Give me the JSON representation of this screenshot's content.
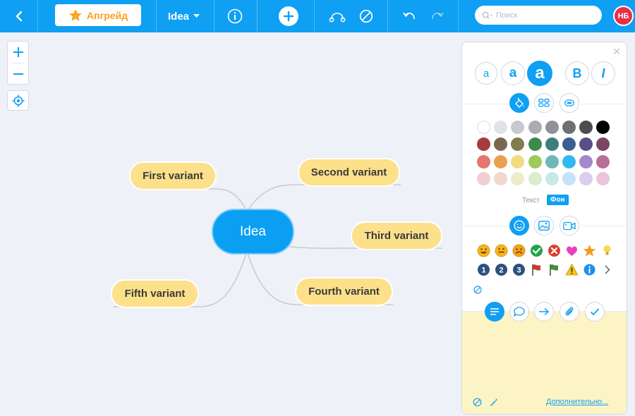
{
  "toolbar": {
    "upgrade_label": "Апгрейд",
    "map_name": "Idea",
    "search_placeholder": "Поиск",
    "avatar_initials": "НБ"
  },
  "map": {
    "root": "Idea",
    "nodes": [
      "First variant",
      "Second variant",
      "Third variant",
      "Fourth variant",
      "Fifth variant"
    ]
  },
  "panel": {
    "font_sizes": [
      "a",
      "a",
      "a"
    ],
    "bold_label": "B",
    "italic_label": "I",
    "color_tabs": {
      "text": "Текст",
      "background": "Фон"
    },
    "more_link": "Дополнительно..."
  },
  "colors": {
    "accent": "#0f9ff3",
    "node_fill": "#fde08a",
    "palette": [
      [
        "#ffffff",
        "#dfe3e8",
        "#c6c9cd",
        "#a9acb0",
        "#8f9296",
        "#6e7174",
        "#4b4d50",
        "#000000"
      ],
      [
        "#a73b3b",
        "#7b6651",
        "#827d4b",
        "#3c8a4d",
        "#3c7e7e",
        "#3b5f8e",
        "#5b4c8a",
        "#7b4662"
      ],
      [
        "#e4766f",
        "#eaa050",
        "#f3dc80",
        "#9ec95d",
        "#6fb7b7",
        "#2fb9f2",
        "#a489c9",
        "#b66f97"
      ],
      [
        "#f0cfcf",
        "#f1d8cb",
        "#eeeacc",
        "#d9eccc",
        "#c8e9e9",
        "#c6e2f6",
        "#dccdee",
        "#eac4dc"
      ]
    ]
  },
  "icons": {
    "row1": [
      "smile-icon",
      "grin-icon",
      "frown-icon",
      "check-icon",
      "cross-icon",
      "heart-icon",
      "star-icon",
      "bulb-icon"
    ],
    "row2": [
      "number-1-icon",
      "number-2-icon",
      "number-3-icon",
      "red-flag-icon",
      "green-flag-icon",
      "warning-icon",
      "info-icon",
      "chevron-right-icon"
    ],
    "numbers": [
      "1",
      "2",
      "3"
    ]
  }
}
